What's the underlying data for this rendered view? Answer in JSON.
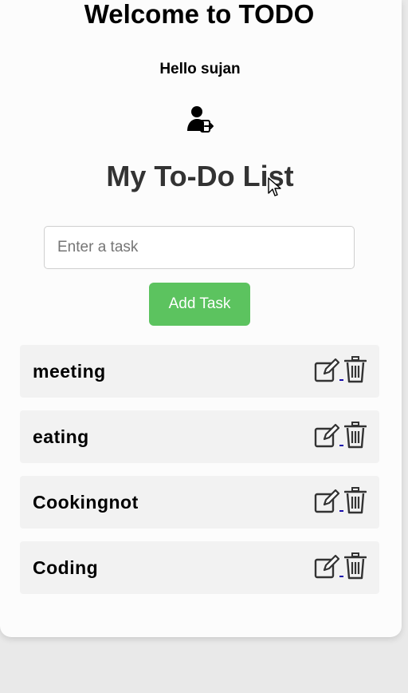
{
  "header": {
    "welcome": "Welcome to TODO",
    "greeting": "Hello sujan",
    "logout_icon": "user-logout-icon"
  },
  "main": {
    "title": "My To-Do List",
    "input": {
      "placeholder": "Enter a task",
      "value": ""
    },
    "add_button_label": "Add Task"
  },
  "tasks": [
    {
      "label": "meeting"
    },
    {
      "label": "eating"
    },
    {
      "label": "Cookingnot"
    },
    {
      "label": "Coding"
    }
  ],
  "icons": {
    "edit": "edit-icon",
    "delete": "trash-icon"
  },
  "colors": {
    "accent": "#5cc35f",
    "background": "#fcfcfc",
    "task_bg": "#f2f2f2"
  }
}
